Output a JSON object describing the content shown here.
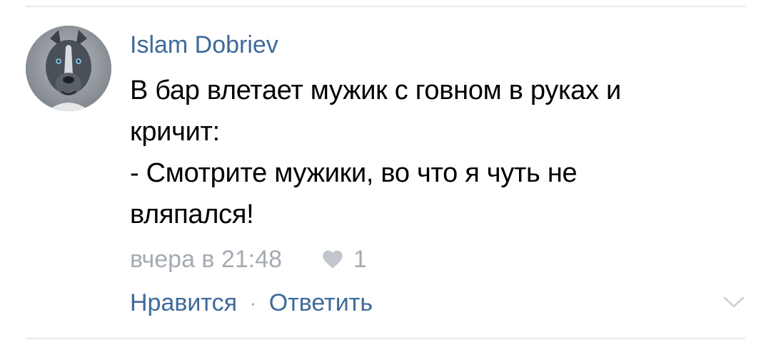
{
  "comment": {
    "author": "Islam Dobriev",
    "text_lines": [
      "В бар влетает мужик с говном в руках и",
      "кричит:",
      "- Смотрите мужики, во что я чуть не",
      "вляпался!"
    ],
    "timestamp": "вчера в 21:48",
    "like_count": "1",
    "actions": {
      "like_label": "Нравится",
      "separator": "·",
      "reply_label": "Ответить"
    },
    "avatar_icon": "dog-avatar",
    "heart_icon": "heart-icon",
    "more_icon": "chevron-down-icon"
  },
  "colors": {
    "link": "#3f6a99",
    "meta": "#a5abb3",
    "text": "#000000",
    "divider": "#e7e8ec"
  }
}
